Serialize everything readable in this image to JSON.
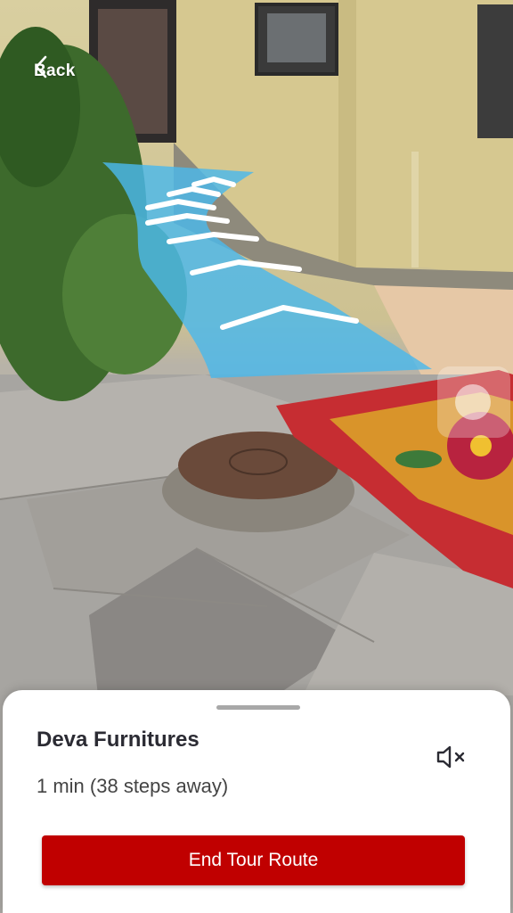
{
  "header": {
    "back_label": "Back"
  },
  "destination": {
    "name": "Deva Furnitures",
    "eta": "1 min (38 steps away)"
  },
  "actions": {
    "end_route_label": "End Tour Route"
  },
  "icons": {
    "back": "chevron-left-icon",
    "mute": "speaker-muted-icon"
  },
  "colors": {
    "accent": "#c00000",
    "ar_path": "#4ab8ec",
    "sheet_bg": "#ffffff",
    "text_primary": "#2b2b33"
  }
}
